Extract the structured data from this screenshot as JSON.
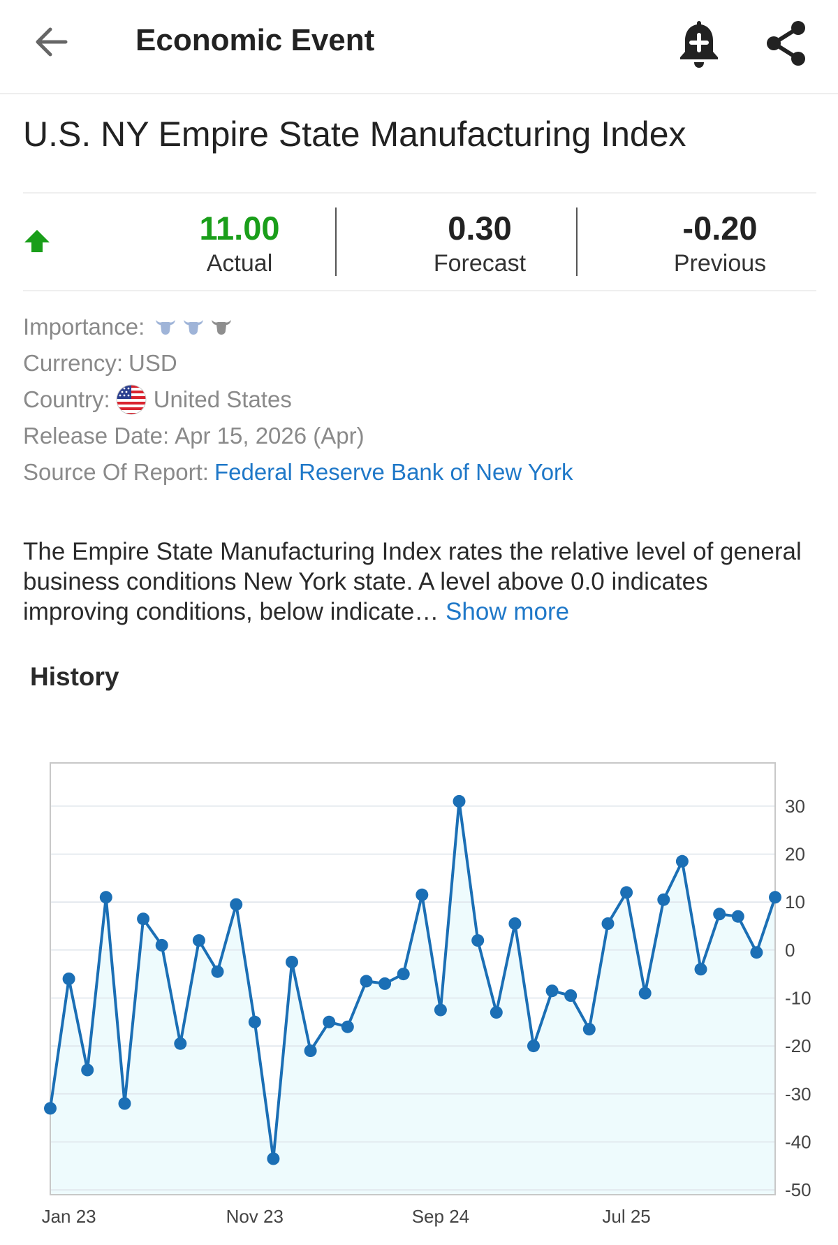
{
  "header": {
    "title": "Economic Event"
  },
  "event": {
    "title": "U.S. NY Empire State Manufacturing Index"
  },
  "values": {
    "actual": {
      "value": "11.00",
      "label": "Actual"
    },
    "forecast": {
      "value": "0.30",
      "label": "Forecast"
    },
    "previous": {
      "value": "-0.20",
      "label": "Previous"
    },
    "trend": "up"
  },
  "details": {
    "importance_label": "Importance:",
    "importance_level": 3,
    "currency_label": "Currency:",
    "currency_value": "USD",
    "country_label": "Country:",
    "country_value": "United States",
    "release_label": "Release Date:",
    "release_value": "Apr 15, 2026 (Apr)",
    "source_label": "Source Of Report:",
    "source_value": "Federal Reserve Bank of New York"
  },
  "description": {
    "text": "The Empire State Manufacturing Index rates the relative level of general business conditions New York state. A level above 0.0 indicates improving conditions, below indicate…",
    "show_more": "Show more"
  },
  "history": {
    "title": "History"
  },
  "colors": {
    "accent": "#1f78c8",
    "positive": "#1a9e1a",
    "line": "#1b6fb5",
    "area": "#eefbfd"
  },
  "chart_data": {
    "type": "area",
    "x_tick_labels": [
      "Jan 23",
      "Nov 23",
      "Sep 24",
      "Jul 25"
    ],
    "x_tick_indices": [
      1,
      11,
      21,
      31
    ],
    "y_ticks": [
      30,
      20,
      10,
      0,
      -10,
      -20,
      -30,
      -40,
      -50
    ],
    "ylim": [
      -51,
      39
    ],
    "y_axis_position": "right",
    "grid": true,
    "series": [
      {
        "values": [
          -33,
          -6,
          -25,
          11,
          -32,
          6.5,
          1,
          -19.5,
          2,
          -4.5,
          9.5,
          -15,
          -43.5,
          -2.5,
          -21,
          -15,
          -16,
          -6.5,
          -7,
          -5,
          11.5,
          -12.5,
          31,
          2,
          -13,
          5.5,
          -20,
          -8.5,
          -9.5,
          -16.5,
          5.5,
          12,
          -9,
          10.5,
          18.5,
          -4,
          7.5,
          7,
          -0.5,
          11
        ]
      }
    ]
  }
}
